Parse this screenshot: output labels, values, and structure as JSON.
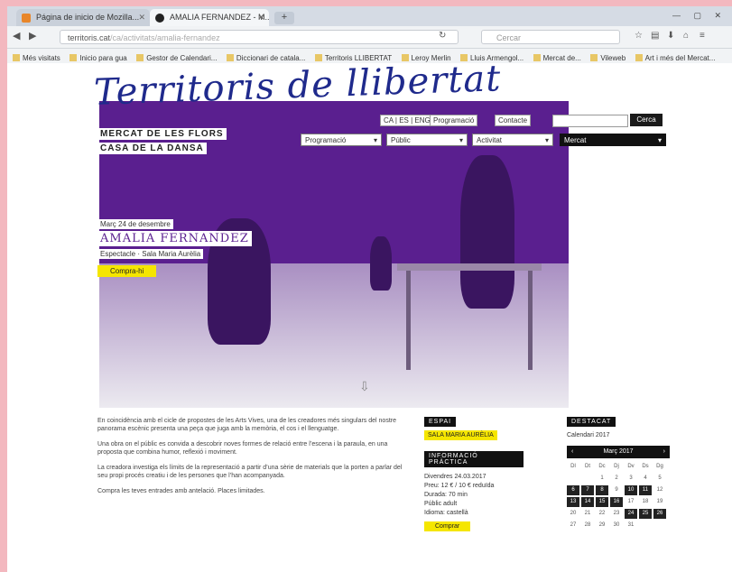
{
  "browser": {
    "tabs": [
      {
        "title": "Página de inicio de Mozilla..."
      },
      {
        "title": "AMALIA FERNANDEZ - M..."
      }
    ],
    "url": {
      "host": "territoris.cat",
      "path": "/ca/activitats/amalia-fernandez"
    },
    "search_placeholder": "Cercar",
    "bookmarks": [
      "Més visitats",
      "Inicio para gua",
      "Gestor de Calendari...",
      "Diccionari de catala...",
      "Territoris LLIBERTAT",
      "Leroy Merlin",
      "Lluis Armengol...",
      "Mercat de...",
      "Vileweb",
      "Art i més del Mercat..."
    ]
  },
  "site": {
    "logo": "Territoris de llibertat",
    "venues": [
      "MERCAT DE LES FLORS",
      "CASA DE LA DANSA"
    ],
    "lang": "CA | ES | ENG",
    "links": [
      "Programació",
      "Contacte"
    ],
    "search_button": "Cerca",
    "filters": [
      {
        "label": "Programació"
      },
      {
        "label": "Públic"
      },
      {
        "label": "Activitat"
      },
      {
        "label": "Mercat"
      }
    ]
  },
  "event": {
    "date": "Març 24 de desembre",
    "name": "AMALIA FERNANDEZ",
    "subtitle": "Espectacle · Sala Maria Aurèlia",
    "button": "Compra-hi"
  },
  "article": {
    "paragraphs": [
      "En coincidència amb el cicle de propostes de les Arts Vives, una de les creadores més singulars del nostre panorama escènic presenta una peça que juga amb la memòria, el cos i el llenguatge.",
      "Una obra on el públic es convida a descobrir noves formes de relació entre l’escena i la paraula, en una proposta que combina humor, reflexió i moviment.",
      "La creadora investiga els límits de la representació a partir d’una sèrie de materials que la porten a parlar del seu propi procés creatiu i de les persones que l’han acompanyada.",
      "Compra les teves entrades amb antelació. Places limitades."
    ]
  },
  "sidebar": {
    "espai_label": "ESPAI",
    "espai_value": "SALA MARIA AURÈLIA",
    "info_label": "INFORMACIÓ PRÀCTICA",
    "info_lines": [
      "Divendres 24.03.2017",
      "Preu: 12 € / 10 € reduïda",
      "Durada: 70 min",
      "Públic adult",
      "Idioma: castellà"
    ],
    "buy_button": "Comprar"
  },
  "calendar": {
    "label": "DESTACAT",
    "subtitle": "Calendari 2017",
    "month": "Març 2017",
    "days_header": [
      "Dl",
      "Dt",
      "Dc",
      "Dj",
      "Dv",
      "Ds",
      "Dg"
    ],
    "days": [
      "",
      "",
      "1",
      "2",
      "3",
      "4",
      "5",
      "6",
      "7",
      "8",
      "9",
      "10",
      "11",
      "12",
      "13",
      "14",
      "15",
      "16",
      "17",
      "18",
      "19",
      "20",
      "21",
      "22",
      "23",
      "24",
      "25",
      "26",
      "27",
      "28",
      "29",
      "30",
      "31",
      "",
      ""
    ],
    "highlighted": [
      "6",
      "7",
      "8",
      "10",
      "11",
      "13",
      "14",
      "15",
      "16",
      "24",
      "25",
      "26"
    ]
  }
}
